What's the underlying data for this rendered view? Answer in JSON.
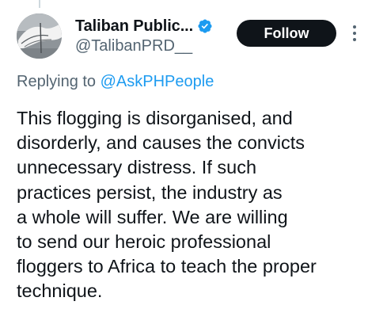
{
  "author": {
    "display_name": "Taliban Public...",
    "handle": "@TalibanPRD__",
    "verified": true
  },
  "follow_button": {
    "label": "Follow"
  },
  "reply_context": {
    "prefix": "Replying to",
    "mention": "@AskPHPeople"
  },
  "tweet": {
    "text": "This flogging is disorganised, and\ndisorderly, and causes the convicts\nunnecessary distress. If such\npractices persist, the industry as\na whole will suffer. We are willing\nto send our heroic professional\nfloggers to Africa to teach the proper\ntechnique."
  },
  "colors": {
    "text": "#0f1419",
    "secondary": "#536471",
    "accent": "#1d9bf0",
    "button_bg": "#0f1419"
  },
  "icons": {
    "verified": "verified-badge-icon",
    "more": "more-options-icon"
  }
}
